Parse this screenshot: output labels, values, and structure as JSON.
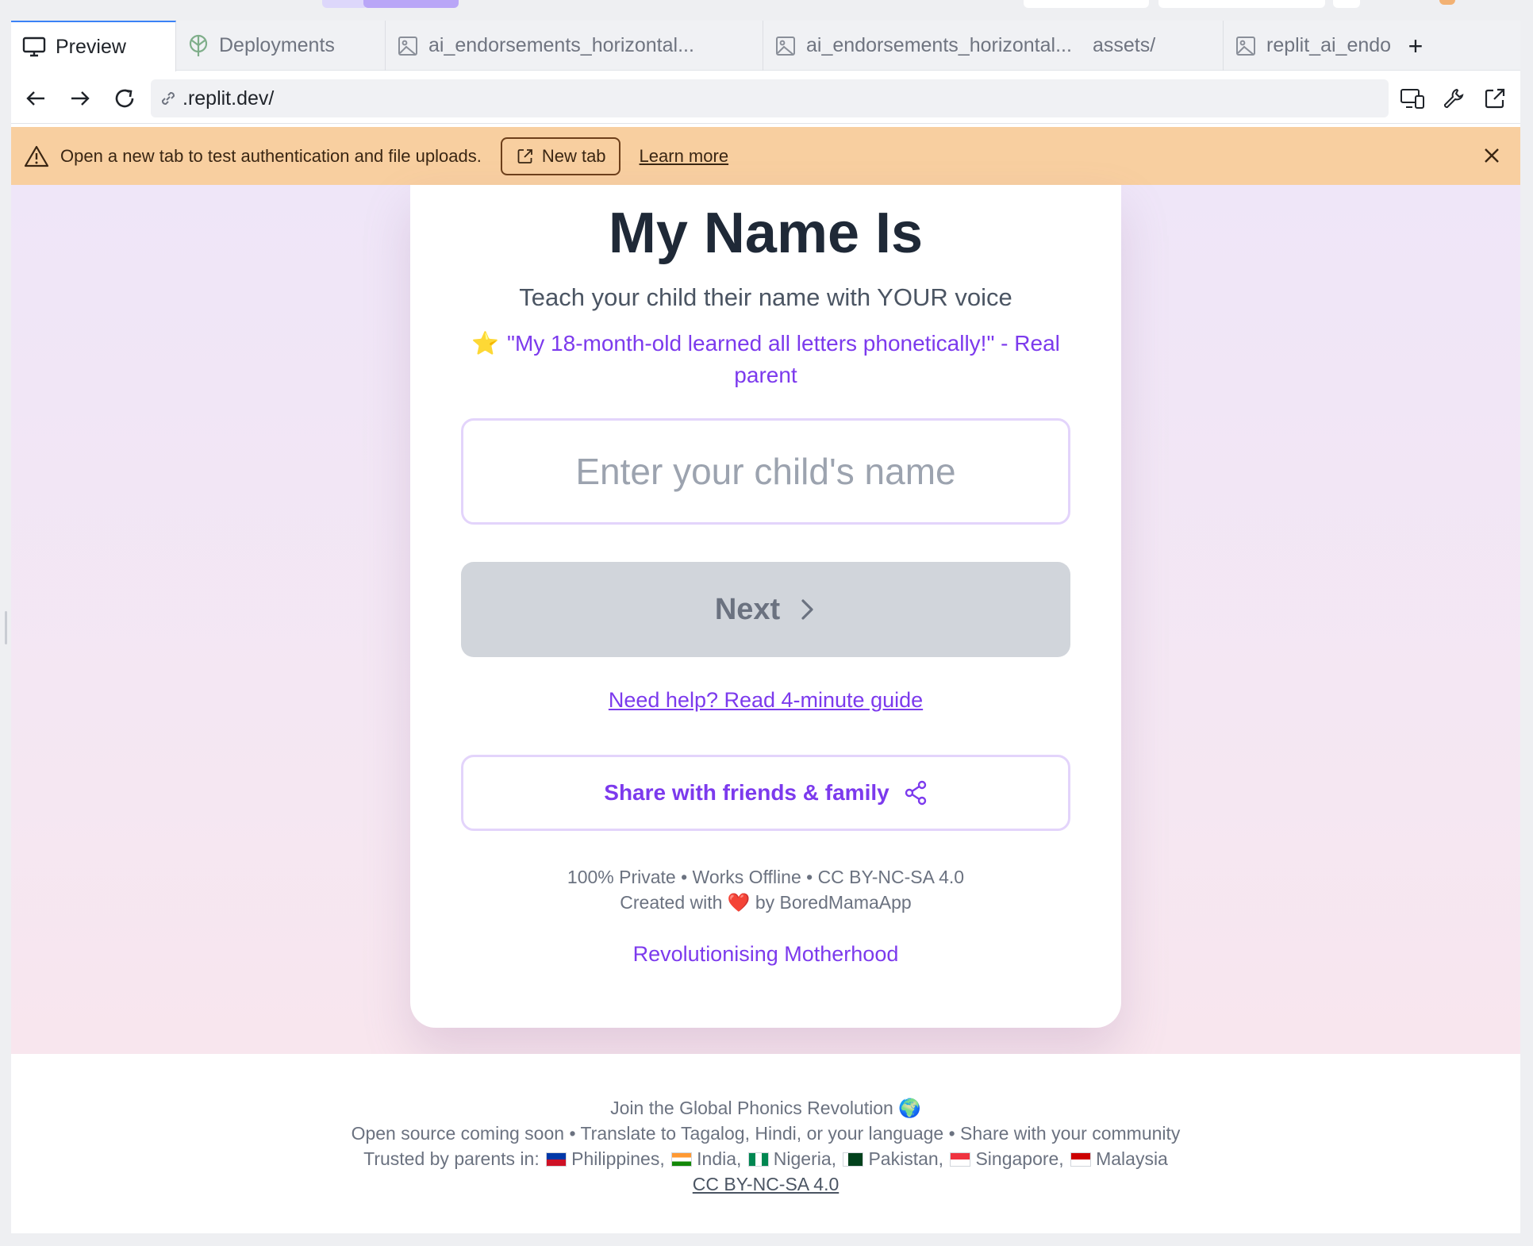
{
  "browser": {
    "tabs": [
      {
        "label": "Preview",
        "icon": "monitor-icon",
        "active": true
      },
      {
        "label": "Deployments",
        "icon": "deployments-icon",
        "active": false
      },
      {
        "label": "ai_endorsements_horizontal...",
        "icon": "image-file-icon",
        "active": false
      },
      {
        "label": "ai_endorsements_horizontal...",
        "extra": "assets/",
        "icon": "image-file-icon",
        "active": false
      },
      {
        "label": "replit_ai_endo",
        "icon": "image-file-icon",
        "active": false
      }
    ],
    "url": ".replit.dev/"
  },
  "banner": {
    "message": "Open a new tab to test authentication and file uploads.",
    "new_tab_label": "New tab",
    "learn_more_label": "Learn more"
  },
  "app": {
    "title": "My Name Is",
    "subtitle": "Teach your child their name with YOUR voice",
    "quote_star": "⭐",
    "quote": "\"My 18-month-old learned all letters phonetically!\" - Real parent",
    "name_placeholder": "Enter your child's name",
    "next_label": "Next",
    "help_link": "Need help? Read 4-minute guide",
    "share_label": "Share with friends & family",
    "footer_line1": "100% Private • Works Offline • CC BY-NC-SA 4.0",
    "footer_line2_a": "Created with",
    "footer_heart": "❤️",
    "footer_line2_b": "by BoredMamaApp",
    "motto": "Revolutionising Motherhood"
  },
  "page_footer": {
    "line1": "Join the Global Phonics Revolution 🌍",
    "line2": "Open source coming soon • Translate to Tagalog, Hindi, or your language • Share with your community",
    "trusted_prefix": "Trusted by parents in:",
    "countries": [
      "Philippines,",
      "India,",
      "Nigeria,",
      "Pakistan,",
      "Singapore,",
      "Malaysia"
    ],
    "license": "CC BY-NC-SA 4.0"
  },
  "colors": {
    "accent_purple": "#7c3aed",
    "banner_bg": "#f8cfa0",
    "disabled_button": "#d1d5db",
    "title_text": "#1f2937"
  }
}
